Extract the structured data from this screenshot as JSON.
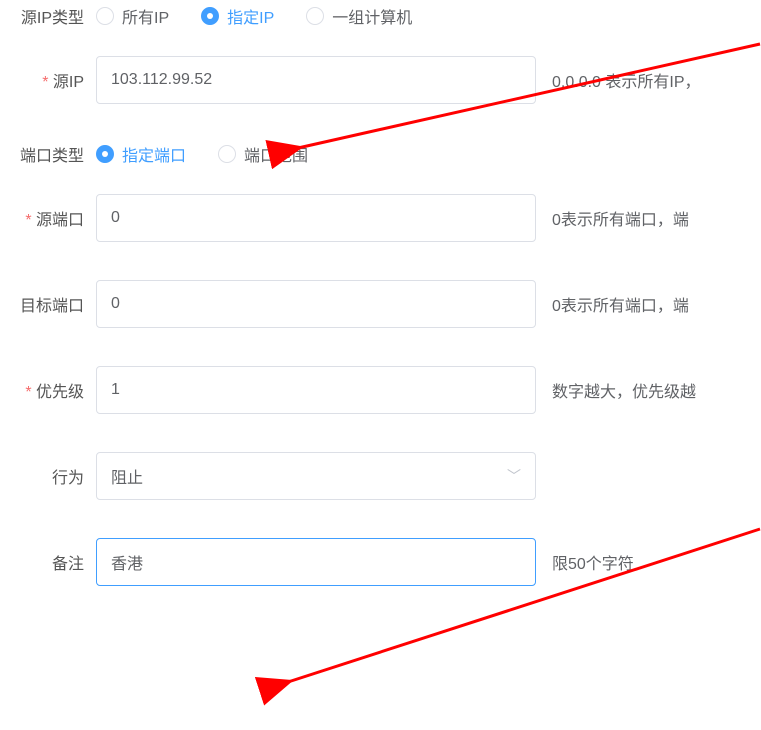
{
  "labels": {
    "source_ip_type": "源IP类型",
    "source_ip": "源IP",
    "port_type": "端口类型",
    "source_port": "源端口",
    "target_port": "目标端口",
    "priority": "优先级",
    "action": "行为",
    "remark": "备注"
  },
  "radio": {
    "ip_all": "所有IP",
    "ip_specific": "指定IP",
    "ip_group": "一组计算机",
    "port_specific": "指定端口",
    "port_range": "端口范围"
  },
  "values": {
    "source_ip": "103.112.99.52",
    "source_port": "0",
    "target_port": "0",
    "priority": "1",
    "action": "阻止",
    "remark": "香港"
  },
  "hints": {
    "source_ip": "0.0.0.0 表示所有IP，",
    "source_port": "0表示所有端口，端",
    "target_port": "0表示所有端口，端",
    "priority": "数字越大，优先级越",
    "remark": "限50个字符"
  }
}
